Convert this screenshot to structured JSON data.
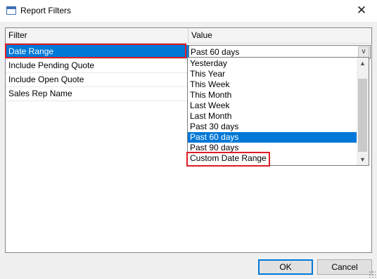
{
  "window": {
    "title": "Report Filters",
    "close_glyph": "✕"
  },
  "grid": {
    "headers": {
      "filter": "Filter",
      "value": "Value"
    },
    "rows": [
      "Date Range",
      "Include Pending Quote",
      "Include Open Quote",
      "Sales Rep Name"
    ],
    "selected_row": "Date Range",
    "combo_value": "Past 60 days",
    "combo_arrow": "∨"
  },
  "dropdown": {
    "options": [
      "Yesterday",
      "This Year",
      "This Week",
      "This Month",
      "Last Week",
      "Last Month",
      "Past 30 days",
      "Past 60 days",
      "Past 90 days",
      "Custom Date Range"
    ],
    "selected": "Past 60 days",
    "scroll_up": "▲",
    "scroll_down": "▼"
  },
  "buttons": {
    "ok": "OK",
    "cancel": "Cancel"
  },
  "colors": {
    "selection": "#0078d7",
    "highlight": "#e01b24"
  },
  "icons": [
    "window-icon",
    "close-icon",
    "chevron-down-icon",
    "scroll-up-icon",
    "scroll-down-icon",
    "resize-grip-icon"
  ]
}
